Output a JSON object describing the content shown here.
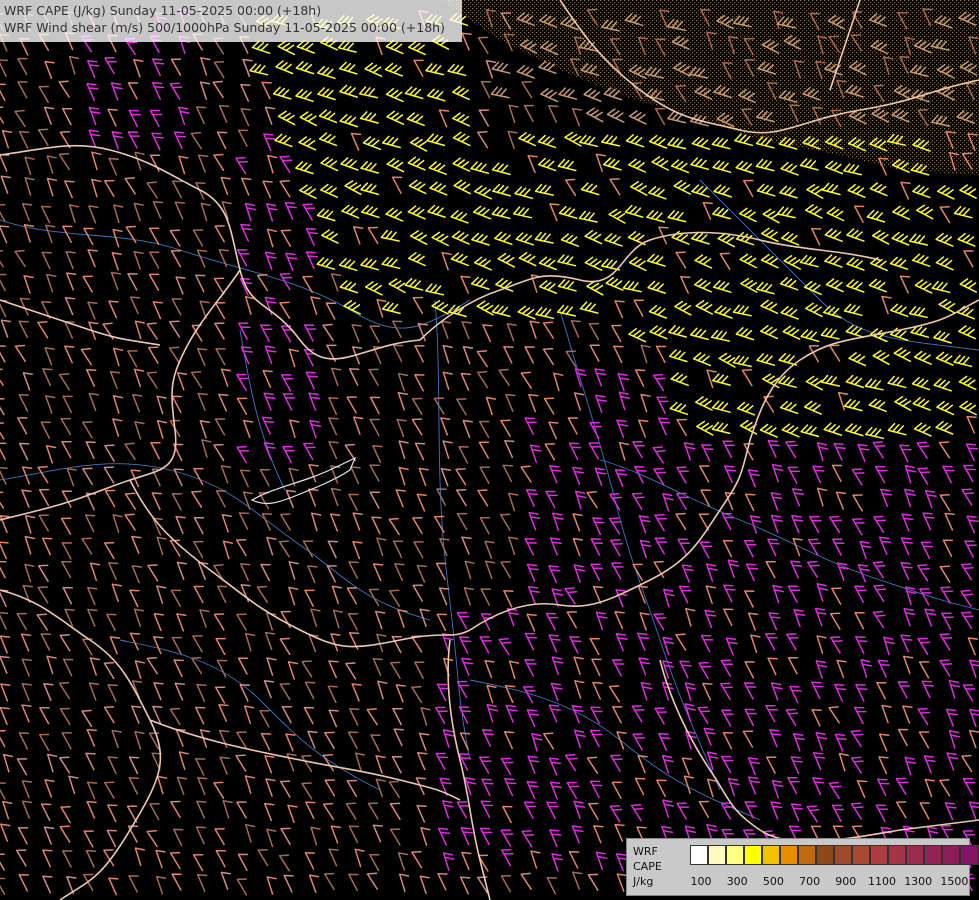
{
  "title": {
    "line1": "WRF CAPE (J/kg) Sunday 11-05-2025 00:00 (+18h)",
    "line2": "WRF Wind shear (m/s) 500/1000hPa Sunday 11-05-2025 00:00 (+18h)"
  },
  "legend": {
    "name_line1": "WRF",
    "name_line2": "CAPE",
    "unit": "J/kg",
    "colors": [
      "#ffffff",
      "#fffbc0",
      "#ffff80",
      "#ffff00",
      "#f2c200",
      "#e88f00",
      "#c06a10",
      "#8c4a18",
      "#9c4a2a",
      "#a84834",
      "#ac3c3e",
      "#a43446",
      "#9c2c4e",
      "#942456",
      "#8c1c5c",
      "#841466",
      "#7c0c6e"
    ],
    "tick_labels": [
      "100",
      "300",
      "500",
      "700",
      "900",
      "1100",
      "1300",
      "1500"
    ]
  },
  "map": {
    "background": "#000000",
    "border_color": "#f0c8b0",
    "river_color": "#3d76c8",
    "barb_colors": {
      "yellow": "#ffff1a",
      "magenta": "#e628e6",
      "salmon": "#e8826a",
      "tan": "#c99a72",
      "brown": "#a86a55",
      "pink": "#d88888"
    }
  }
}
